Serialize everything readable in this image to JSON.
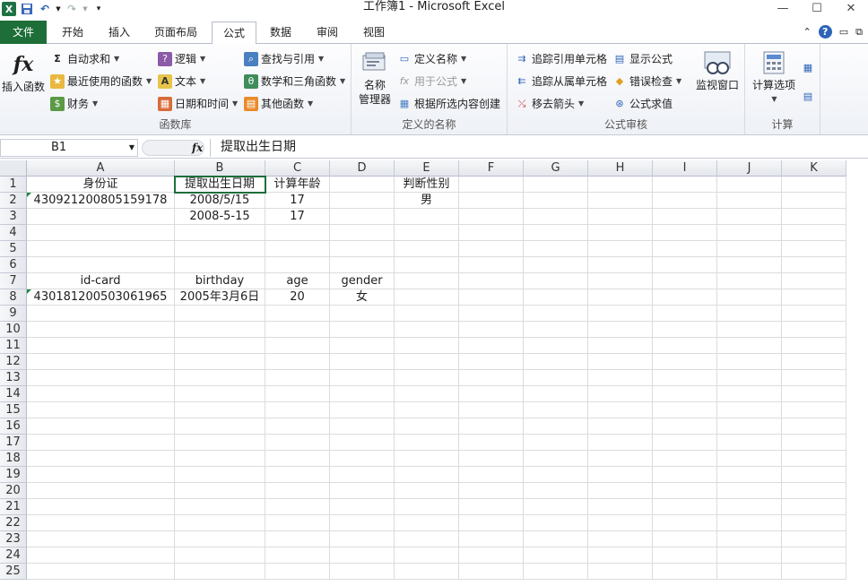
{
  "window": {
    "title": "工作簿1 - Microsoft Excel"
  },
  "tabs": [
    "文件",
    "开始",
    "插入",
    "页面布局",
    "公式",
    "数据",
    "审阅",
    "视图"
  ],
  "active_tab": "公式",
  "ribbon": {
    "function_library": {
      "insert_function": "插入函数",
      "autosum": "自动求和",
      "recent": "最近使用的函数",
      "financial": "财务",
      "logical": "逻辑",
      "text": "文本",
      "datetime": "日期和时间",
      "lookup": "查找与引用",
      "math": "数学和三角函数",
      "more": "其他函数",
      "label": "函数库"
    },
    "defined_names": {
      "name_manager_l1": "名称",
      "name_manager_l2": "管理器",
      "define_name": "定义名称",
      "use_in_formula": "用于公式",
      "create_from_selection": "根据所选内容创建",
      "label": "定义的名称"
    },
    "formula_auditing": {
      "trace_precedents": "追踪引用单元格",
      "trace_dependents": "追踪从属单元格",
      "remove_arrows": "移去箭头",
      "show_formulas": "显示公式",
      "error_checking": "错误检查",
      "evaluate_formula": "公式求值",
      "watch_window": "监视窗口",
      "label": "公式审核"
    },
    "calculation": {
      "options": "计算选项",
      "label": "计算"
    }
  },
  "formula_bar": {
    "name_box": "B1",
    "fx": "fx",
    "content": "提取出生日期"
  },
  "columns": [
    "A",
    "B",
    "C",
    "D",
    "E",
    "F",
    "G",
    "H",
    "I",
    "J",
    "K"
  ],
  "rows": [
    "1",
    "2",
    "3",
    "4",
    "5",
    "6",
    "7",
    "8",
    "9",
    "10",
    "11",
    "12",
    "13",
    "14",
    "15",
    "16",
    "17",
    "18",
    "19",
    "20",
    "21",
    "22",
    "23",
    "24",
    "25"
  ],
  "cells": {
    "A1": "身份证",
    "B1": "提取出生日期",
    "C1": "计算年龄",
    "E1": "判断性别",
    "A2": "430921200805159178",
    "B2": "2008/5/15",
    "C2": "17",
    "E2": "男",
    "B3": "2008-5-15",
    "C3": "17",
    "A7": "id-card",
    "B7": "birthday",
    "C7": "age",
    "D7": "gender",
    "A8": "430181200503061965",
    "B8": "2005年3月6日",
    "C8": "20",
    "D8": "女"
  },
  "selected_cell": "B1"
}
